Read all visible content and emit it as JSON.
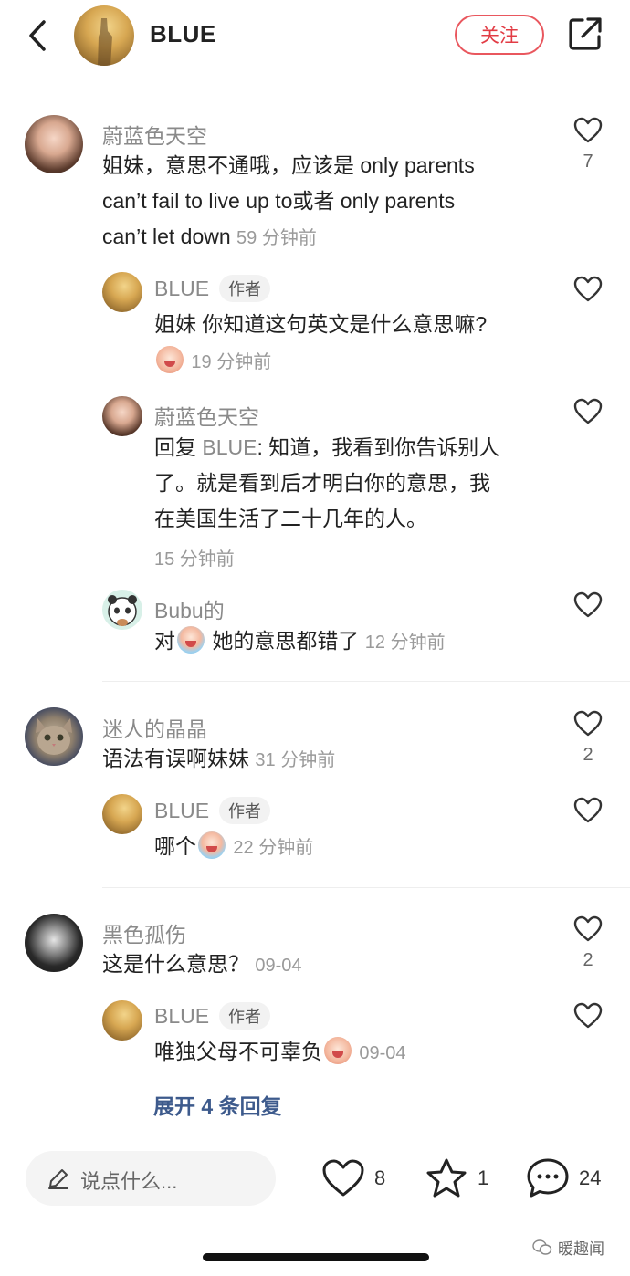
{
  "header": {
    "title": "BLUE",
    "follow_label": "关注"
  },
  "comments": [
    {
      "name": "蔚蓝色天空",
      "text": "姐妹，意思不通哦，应该是 only parents can’t fail to live up to或者 only parents can’t let down",
      "line1": "姐妹，意思不通哦，应该是 only parents",
      "line2": "can’t fail to live up to或者 only parents",
      "line3": "can’t let down",
      "time": "59 分钟前",
      "likes": "7",
      "replies": [
        {
          "name": "BLUE",
          "author_tag": "作者",
          "text": "姐妹 你知道这句英文是什么意思嘛?",
          "time": "19 分钟前"
        },
        {
          "name": "蔚蓝色天空",
          "reply_prefix": "回复",
          "reply_target": "BLUE",
          "line1": "知道，我看到你告诉别人",
          "line2": "了。就是看到后才明白你的意思，我",
          "line3": "在美国生活了二十几年的人。",
          "time": "15 分钟前"
        },
        {
          "name": "Bubu的",
          "text_a": "对",
          "text_b": "她的意思都错了",
          "time": "12 分钟前"
        }
      ]
    },
    {
      "name": "迷人的晶晶",
      "text": "语法有误啊妹妹",
      "time": "31 分钟前",
      "likes": "2",
      "replies": [
        {
          "name": "BLUE",
          "author_tag": "作者",
          "text": "哪个",
          "time": "22 分钟前"
        }
      ]
    },
    {
      "name": "黑色孤伤",
      "text": "这是什么意思？",
      "time": "09-04",
      "likes": "2",
      "replies": [
        {
          "name": "BLUE",
          "author_tag": "作者",
          "text": "唯独父母不可辜负",
          "time": "09-04"
        }
      ],
      "expand_label": "展开 4 条回复"
    }
  ],
  "bottom_bar": {
    "input_placeholder": "说点什么...",
    "likes": "8",
    "favorites": "1",
    "comments": "24"
  },
  "watermark": "暖趣闻",
  "colors": {
    "follow_red": "#e23c45",
    "link_blue": "#3d5a8c",
    "meta_gray": "#8a8a8a"
  },
  "icons": [
    "back-arrow-icon",
    "share-icon",
    "heart-icon",
    "star-icon",
    "comment-bubble-icon",
    "pencil-icon",
    "emoji-icon",
    "wechat-icon"
  ]
}
